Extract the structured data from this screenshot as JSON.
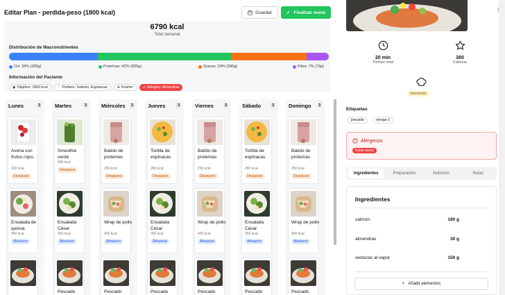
{
  "header": {
    "title": "Editar Plan - perdida-peso (1800 kcal)",
    "save_label": "Guardar",
    "finalize_label": "Finalizar menú"
  },
  "summary": {
    "total": "6790 kcal",
    "total_label": "Total semanal",
    "macro_title": "Distribución de Macronutrientes",
    "macros": [
      {
        "label": "CH: 28% (335g)",
        "pct": 28,
        "color": "#3b82f6"
      },
      {
        "label": "Proteínas: 42% (505g)",
        "pct": 42,
        "color": "#22c55e"
      },
      {
        "label": "Grasas: 24% (286g)",
        "pct": 24,
        "color": "#f97316"
      },
      {
        "label": "Fibra: 7% (79g)",
        "pct": 7,
        "color": "#a855f7"
      }
    ],
    "patient_title": "Información del Paciente",
    "patient_pills": [
      {
        "label": "Objetivo: 1800 kcal",
        "icon": "target-icon",
        "style": "normal"
      },
      {
        "label": "Prefiere: Salmón, Espinacas",
        "icon": "heart-icon",
        "style": "normal"
      },
      {
        "label": "Kosher",
        "icon": "globe-icon",
        "style": "normal"
      },
      {
        "label": "Alérgias: Almendras",
        "icon": "alert-icon",
        "style": "red"
      }
    ]
  },
  "days": [
    {
      "name": "Lunes",
      "count": "3",
      "meals": [
        {
          "name": "Avena con frutos rojos",
          "kcal": "320 kcal",
          "tag": "Desayuno",
          "type": "des",
          "img": "oats"
        },
        {
          "name": "Ensalada de quinoa",
          "kcal": "450 kcal",
          "tag": "Almuerzo",
          "type": "alm",
          "img": "quinoa"
        },
        {
          "name": "",
          "kcal": "",
          "tag": "",
          "type": "",
          "img": "fish"
        }
      ]
    },
    {
      "name": "Martes",
      "count": "3",
      "meals": [
        {
          "name": "Smoothie verde",
          "kcal": "280 kcal",
          "tag": "Desayuno",
          "type": "des",
          "img": "smoothie"
        },
        {
          "name": "Ensalada César",
          "kcal": "350 kcal",
          "tag": "Almuerzo",
          "type": "alm",
          "img": "caesar"
        },
        {
          "name": "Pescado",
          "kcal": "",
          "tag": "",
          "type": "",
          "img": "fish"
        }
      ]
    },
    {
      "name": "Miércoles",
      "count": "3",
      "meals": [
        {
          "name": "Batido de proteínas",
          "kcal": "250 kcal",
          "tag": "Desayuno",
          "type": "des",
          "img": "shake"
        },
        {
          "name": "Wrap de pollo",
          "kcal": "400 kcal",
          "tag": "Almuerzo",
          "type": "alm",
          "img": "wrap"
        },
        {
          "name": "Pescado",
          "kcal": "",
          "tag": "",
          "type": "",
          "img": "fish"
        }
      ]
    },
    {
      "name": "Jueves",
      "count": "3",
      "meals": [
        {
          "name": "Tortilla de espinacas",
          "kcal": "280 kcal",
          "tag": "Desayuno",
          "type": "des",
          "img": "tortilla"
        },
        {
          "name": "Ensalada César",
          "kcal": "350 kcal",
          "tag": "Almuerzo",
          "type": "alm",
          "img": "caesar"
        },
        {
          "name": "Pescado",
          "kcal": "",
          "tag": "",
          "type": "",
          "img": "fish"
        }
      ]
    },
    {
      "name": "Viernes",
      "count": "3",
      "meals": [
        {
          "name": "Batido de proteínas",
          "kcal": "250 kcal",
          "tag": "Desayuno",
          "type": "des",
          "img": "shake"
        },
        {
          "name": "Wrap de pollo",
          "kcal": "400 kcal",
          "tag": "Almuerzo",
          "type": "alm",
          "img": "wrap"
        },
        {
          "name": "Pescado",
          "kcal": "",
          "tag": "",
          "type": "",
          "img": "fish"
        }
      ]
    },
    {
      "name": "Sábado",
      "count": "3",
      "meals": [
        {
          "name": "Tortilla de espinacas",
          "kcal": "280 kcal",
          "tag": "Desayuno",
          "type": "des",
          "img": "tortilla"
        },
        {
          "name": "Ensalada César",
          "kcal": "350 kcal",
          "tag": "Almuerzo",
          "type": "alm",
          "img": "caesar"
        },
        {
          "name": "Pescado",
          "kcal": "",
          "tag": "",
          "type": "",
          "img": "fish"
        }
      ]
    },
    {
      "name": "Domingo",
      "count": "3",
      "meals": [
        {
          "name": "Batido de proteínas",
          "kcal": "250 kcal",
          "tag": "Desayuno",
          "type": "des",
          "img": "shake"
        },
        {
          "name": "Wrap de pollo",
          "kcal": "400 kcal",
          "tag": "Almuerzo",
          "type": "alm",
          "img": "wrap"
        },
        {
          "name": "Pescado",
          "kcal": "",
          "tag": "",
          "type": "",
          "img": "fish"
        }
      ]
    }
  ],
  "detail": {
    "time_value": "20 min",
    "time_label": "Tiempo total",
    "cal_value": "380",
    "cal_label": "Calorías",
    "level": "Intermedio",
    "tags_title": "Etiquetas",
    "tags": [
      "pescado",
      "omega-3"
    ],
    "allergens_title": "Alérgenos",
    "allergen": "frutos secos",
    "tabs": [
      "Ingredientes",
      "Preparación",
      "Nutrición",
      "Notas"
    ],
    "ingredients_title": "Ingredientes",
    "ingredients": [
      {
        "name": "salmón",
        "qty": "180 g"
      },
      {
        "name": "almendras",
        "qty": "30 g"
      },
      {
        "name": "verduras al vapor",
        "qty": "150 g"
      }
    ],
    "add_label": "Añadir elementos"
  }
}
